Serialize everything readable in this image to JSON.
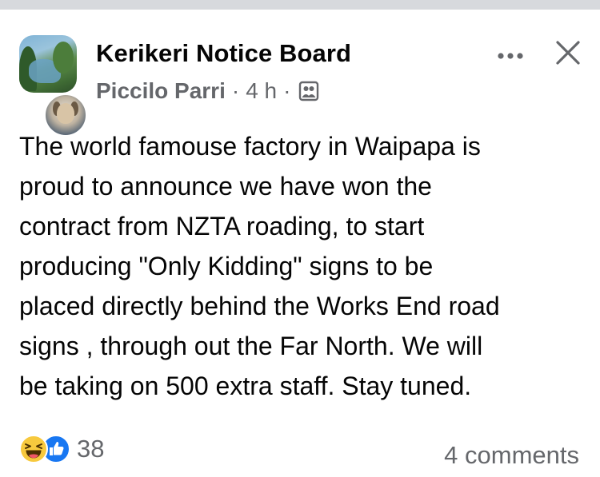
{
  "post": {
    "group_name": "Kerikeri Notice Board",
    "author": "Piccilo Parri",
    "separator": "·",
    "time": "4 h",
    "audience_icon": "group-audience-icon",
    "body_lines": [
      "The world famouse factory in Waipapa is",
      "proud to announce we have won the",
      "contract from NZTA roading,  to start",
      "producing \"Only Kidding\" signs to be",
      "placed directly behind the Works End road",
      "signs , through out the Far North.  We will",
      "be taking on 500 extra staff. Stay tuned."
    ]
  },
  "header_actions": {
    "more_icon": "more-dots-icon",
    "close_icon": "close-icon"
  },
  "footer": {
    "reaction_icons": [
      "haha-icon",
      "like-icon"
    ],
    "reaction_count": "38",
    "comments": "4 comments"
  },
  "colors": {
    "text_primary": "#050505",
    "text_secondary": "#65676b",
    "like_blue": "#1877f2",
    "haha_yellow": "#f7c93e",
    "top_bar": "#d7d9dd"
  }
}
